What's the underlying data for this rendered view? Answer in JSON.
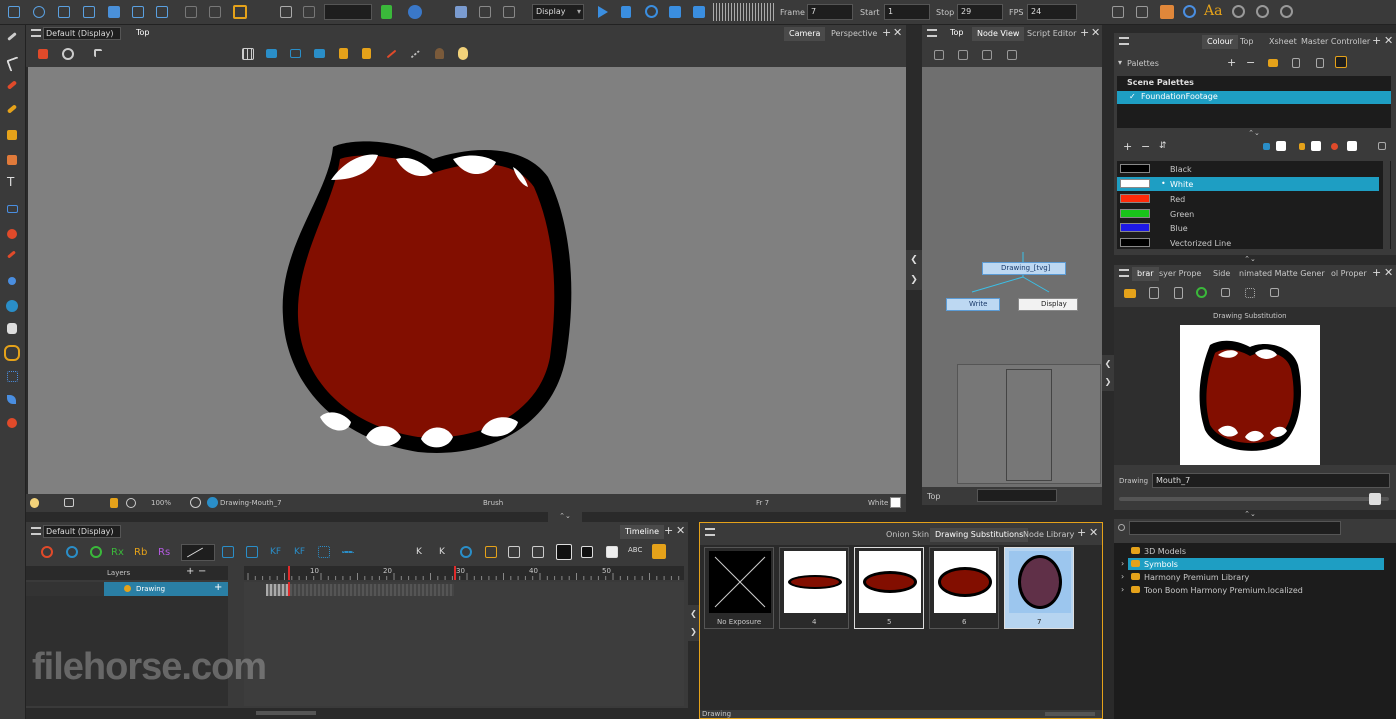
{
  "toolbar": {
    "display_value": "Display",
    "frame_label": "Frame",
    "frame_value": "7",
    "start_label": "Start",
    "start_value": "1",
    "stop_label": "Stop",
    "stop_value": "29",
    "fps_label": "FPS",
    "fps_value": "24"
  },
  "camera_view": {
    "view_menu": "Default (Display)",
    "view_mode": "Top",
    "tabs": [
      "Camera",
      "Perspective"
    ],
    "status_zoom": "100%",
    "status_drawing": "Drawing-Mouth_7",
    "status_tool": "Brush",
    "status_frame": "Fr 7",
    "status_color": "White"
  },
  "node_view": {
    "view_mode": "Top",
    "tabs": [
      "Node View",
      "Script Editor"
    ],
    "nodes": [
      "Drawing_[tvg]",
      "Write",
      "Display"
    ],
    "footer_label": "Top"
  },
  "colour_panel": {
    "tabs": [
      "Colour",
      "Top",
      "Xsheet",
      "Master Controller"
    ],
    "palettes_label": "Palettes",
    "scene_palettes_header": "Scene Palettes",
    "palette_item": "FoundationFootage",
    "swatches": [
      {
        "name": "Black",
        "color": "#000000"
      },
      {
        "name": "White",
        "color": "#ffffff"
      },
      {
        "name": "Red",
        "color": "#ff2a0a"
      },
      {
        "name": "Green",
        "color": "#19c41a"
      },
      {
        "name": "Blue",
        "color": "#1e19e6"
      },
      {
        "name": "Vectorized Line",
        "color": "#000000"
      }
    ]
  },
  "library_panel": {
    "tabs": [
      "brar",
      "syer Prope",
      "Side",
      "nimated Matte Gener",
      "ol Proper"
    ],
    "preview_title": "Drawing Substitution",
    "drawing_label": "Drawing",
    "drawing_value": "Mouth_7"
  },
  "timeline": {
    "view_menu": "Default (Display)",
    "tab": "Timeline",
    "layers_label": "Layers",
    "layer_name": "Drawing",
    "ruler_ticks": [
      "10",
      "20",
      "30",
      "40",
      "50"
    ]
  },
  "substitutions": {
    "tabs": [
      "Onion Skin",
      "Drawing Substitutions",
      "Node Library"
    ],
    "items": [
      {
        "label": "No Exposure"
      },
      {
        "label": "4"
      },
      {
        "label": "5"
      },
      {
        "label": "6"
      },
      {
        "label": "7"
      }
    ],
    "footer_label": "Drawing"
  },
  "library_tree": {
    "items": [
      "3D Models",
      "Symbols",
      "Harmony Premium Library",
      "Toon Boom Harmony Premium.localized"
    ]
  },
  "watermark": "filehorse.com"
}
